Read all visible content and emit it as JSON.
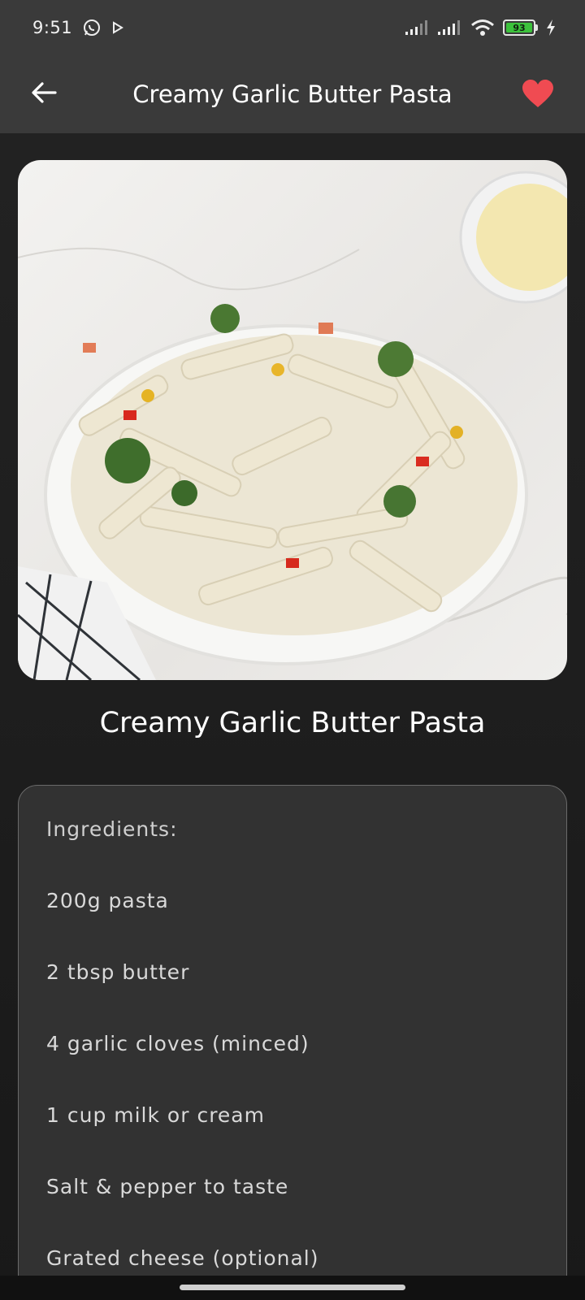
{
  "status": {
    "time": "9:51",
    "battery": "93",
    "icons": [
      "whatsapp-icon",
      "play-icon",
      "signal-icon",
      "signal-icon",
      "wifi-icon",
      "battery-icon",
      "charging-icon"
    ]
  },
  "app_bar": {
    "title": "Creamy Garlic Butter Pasta",
    "back_icon": "back-arrow-icon",
    "favorite_icon": "heart-icon",
    "favorite_color": "#f04b52"
  },
  "recipe": {
    "title": "Creamy Garlic Butter Pasta",
    "ingredients_heading": "Ingredients:",
    "ingredients": [
      "200g pasta",
      "2 tbsp butter",
      "4 garlic cloves (minced)",
      "1 cup milk or cream",
      "Salt & pepper to taste",
      "Grated cheese (optional)"
    ]
  },
  "colors": {
    "bar_background": "#3a3a3a",
    "page_background": "#1f1f1f",
    "card_background": "#323232"
  }
}
